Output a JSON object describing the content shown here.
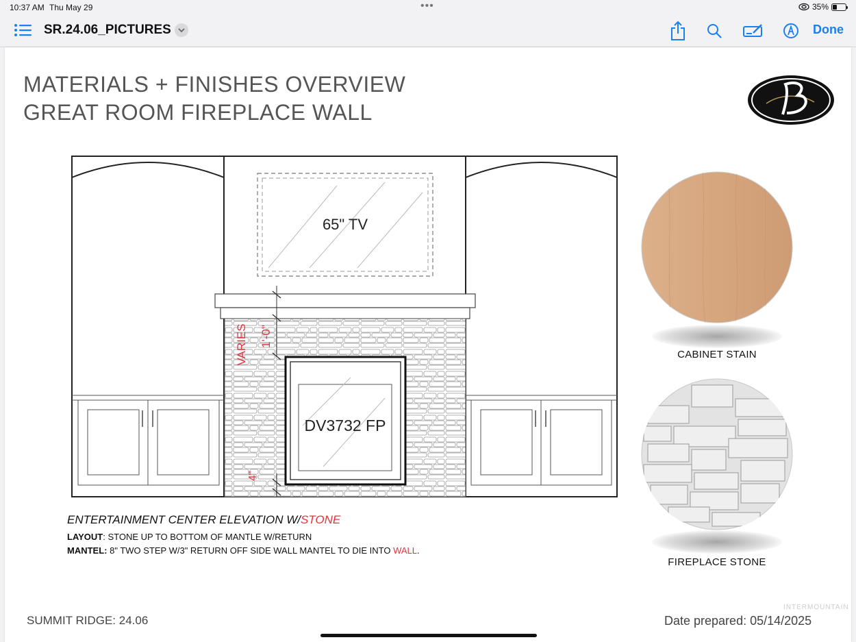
{
  "status_bar": {
    "time": "10:37 AM",
    "date": "Thu May 29",
    "battery": "35%"
  },
  "nav": {
    "title": "SR.24.06_PICTURES",
    "done_label": "Done"
  },
  "document": {
    "heading_line1": "MATERIALS + FINISHES OVERVIEW",
    "heading_line2": "GREAT ROOM FIREPLACE WALL",
    "drawing_labels": {
      "tv": "65\" TV",
      "fireplace": "DV3732 FP",
      "varies": "VARIES",
      "dim_mantel": "1'-0\"",
      "dim_hearth": "4\""
    },
    "caption_main": "ENTERTAINMENT CENTER ELEVATION W/",
    "caption_accent": "STONE",
    "layout_label": "LAYOUT",
    "layout_text": ": STONE UP TO BOTTOM OF MANTLE W/RETURN",
    "mantel_label": "MANTEL:",
    "mantel_text": " 8\" TWO STEP W/3\" RETURN OFF SIDE WALL MANTEL TO DIE INTO ",
    "mantel_accent": "WALL",
    "mantel_end": ".",
    "swatch_cabinet": "CABINET STAIN",
    "swatch_stone": "FIREPLACE STONE",
    "footer_left": "SUMMIT RIDGE: 24.06",
    "footer_right": "Date prepared: 05/14/2025",
    "watermark": "INTERMOUNTAIN"
  },
  "colors": {
    "accent": "#1a7ff0",
    "red": "#e2333c",
    "wood": "#d9a982",
    "stone": "#dcdcdc"
  },
  "icons": [
    "list-icon",
    "chevron-down-icon",
    "share-icon",
    "search-icon",
    "markup-icon",
    "pen-icon",
    "wifi-icon",
    "battery-icon"
  ]
}
